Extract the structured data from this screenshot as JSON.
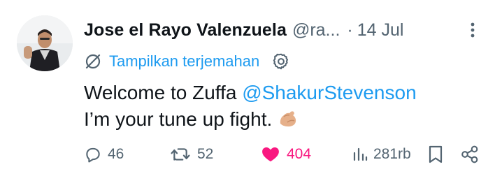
{
  "author": {
    "name": "Jose el Rayo Valenzuela",
    "handle": "@ra...",
    "separator": "·",
    "date": "14 Jul"
  },
  "translate": {
    "label": "Tampilkan terjemahan"
  },
  "body": {
    "line1_text": "Welcome to Zuffa ",
    "mention": "@ShakurStevenson",
    "line2_text": "I’m your tune up fight."
  },
  "actions": {
    "replies": "46",
    "reposts": "52",
    "likes": "404",
    "views": "281rb"
  },
  "colors": {
    "text": "#0f1419",
    "secondary": "#536471",
    "link": "#1d9bf0",
    "like": "#f91880"
  },
  "icons": [
    "more-icon",
    "translate-icon",
    "gear-icon",
    "flexed-biceps-emoji",
    "reply-icon",
    "repost-icon",
    "heart-icon",
    "views-icon",
    "bookmark-icon",
    "share-icon"
  ]
}
